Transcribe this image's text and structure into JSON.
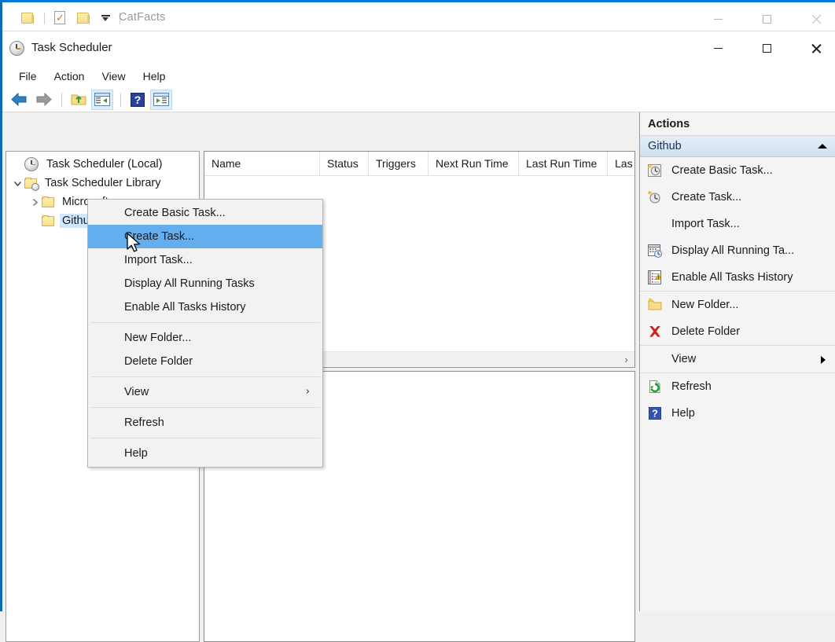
{
  "outer_window": {
    "title": "CatFacts",
    "quick_access": [
      {
        "name": "folder-icon-1",
        "label": ""
      },
      {
        "name": "properties-doc-icon",
        "label": ""
      },
      {
        "name": "folder-icon-2",
        "label": ""
      },
      {
        "name": "customize-dropdown-icon",
        "label": ""
      }
    ],
    "controls": {
      "minimize": "—",
      "maximize": "☐",
      "close": "✕"
    },
    "accent_color": "#0078d7"
  },
  "task_scheduler": {
    "title": "Task Scheduler",
    "controls": {
      "minimize": "—",
      "maximize": "☐",
      "close": "✕"
    },
    "menubar": [
      "File",
      "Action",
      "View",
      "Help"
    ],
    "toolbar": [
      {
        "name": "back-arrow-icon",
        "tooltip": "Back"
      },
      {
        "name": "forward-arrow-icon",
        "tooltip": "Forward"
      },
      {
        "name": "up-one-level-folder-icon",
        "tooltip": "Up One Level"
      },
      {
        "name": "show-hide-console-tree-icon",
        "tooltip": "Show/Hide Console Tree"
      },
      {
        "name": "help-icon",
        "tooltip": "Help"
      },
      {
        "name": "show-hide-action-pane-icon",
        "tooltip": "Show/Hide Action Pane"
      }
    ]
  },
  "tree": {
    "items": [
      {
        "label": "Task Scheduler (Local)",
        "icon": "clock-icon",
        "indent": 0,
        "chevron": "none",
        "selected": false
      },
      {
        "label": "Task Scheduler Library",
        "icon": "library-folder-icon",
        "indent": 1,
        "chevron": "expanded",
        "selected": false
      },
      {
        "label": "Microsoft",
        "icon": "folder-icon",
        "indent": 2,
        "chevron": "collapsed",
        "selected": false
      },
      {
        "label": "Github",
        "icon": "folder-icon",
        "indent": 2,
        "chevron": "none",
        "selected": true
      }
    ]
  },
  "list_view": {
    "columns": [
      {
        "label": "Name",
        "width": 147
      },
      {
        "label": "Status",
        "width": 62
      },
      {
        "label": "Triggers",
        "width": 76
      },
      {
        "label": "Next Run Time",
        "width": 115
      },
      {
        "label": "Last Run Time",
        "width": 113
      },
      {
        "label": "Las",
        "width": 34
      }
    ],
    "rows": [],
    "scrollbar": {
      "name": "horizontal-scrollbar",
      "right_arrow": "›"
    }
  },
  "context_menu": {
    "items": [
      {
        "label": "Create Basic Task...",
        "type": "item",
        "highlighted": false
      },
      {
        "label": "Create Task...",
        "type": "item",
        "highlighted": true
      },
      {
        "label": "Import Task...",
        "type": "item",
        "highlighted": false
      },
      {
        "label": "Display All Running Tasks",
        "type": "item",
        "highlighted": false
      },
      {
        "label": "Enable All Tasks History",
        "type": "item",
        "highlighted": false
      },
      {
        "label": "",
        "type": "separator",
        "highlighted": false
      },
      {
        "label": "New Folder...",
        "type": "item",
        "highlighted": false
      },
      {
        "label": "Delete Folder",
        "type": "item",
        "highlighted": false
      },
      {
        "label": "",
        "type": "separator",
        "highlighted": false
      },
      {
        "label": "View",
        "type": "submenu",
        "highlighted": false,
        "arrow": "›"
      },
      {
        "label": "",
        "type": "separator",
        "highlighted": false
      },
      {
        "label": "Refresh",
        "type": "item",
        "highlighted": false
      },
      {
        "label": "",
        "type": "separator",
        "highlighted": false
      },
      {
        "label": "Help",
        "type": "item",
        "highlighted": false
      }
    ],
    "highlight_color": "#64aeee"
  },
  "actions_pane": {
    "title": "Actions",
    "group_title": "Github",
    "items": [
      {
        "label": "Create Basic Task...",
        "icon": "create-basic-task-icon",
        "type": "item"
      },
      {
        "label": "Create Task...",
        "icon": "create-task-icon",
        "type": "item"
      },
      {
        "label": "Import Task...",
        "icon": "none",
        "type": "item"
      },
      {
        "label": "Display All Running Ta...",
        "icon": "display-running-tasks-icon",
        "type": "item"
      },
      {
        "label": "Enable All Tasks History",
        "icon": "enable-history-icon",
        "type": "item"
      },
      {
        "label": "",
        "icon": "none",
        "type": "separator"
      },
      {
        "label": "New Folder...",
        "icon": "new-folder-icon",
        "type": "item"
      },
      {
        "label": "Delete Folder",
        "icon": "delete-folder-icon",
        "type": "item"
      },
      {
        "label": "",
        "icon": "none",
        "type": "separator"
      },
      {
        "label": "View",
        "icon": "none",
        "type": "submenu"
      },
      {
        "label": "",
        "icon": "none",
        "type": "separator"
      },
      {
        "label": "Refresh",
        "icon": "refresh-icon",
        "type": "item"
      },
      {
        "label": "Help",
        "icon": "help-icon",
        "type": "item"
      }
    ],
    "header_gradient_top": "#e6eff8",
    "header_gradient_bottom": "#cfe0f0"
  }
}
